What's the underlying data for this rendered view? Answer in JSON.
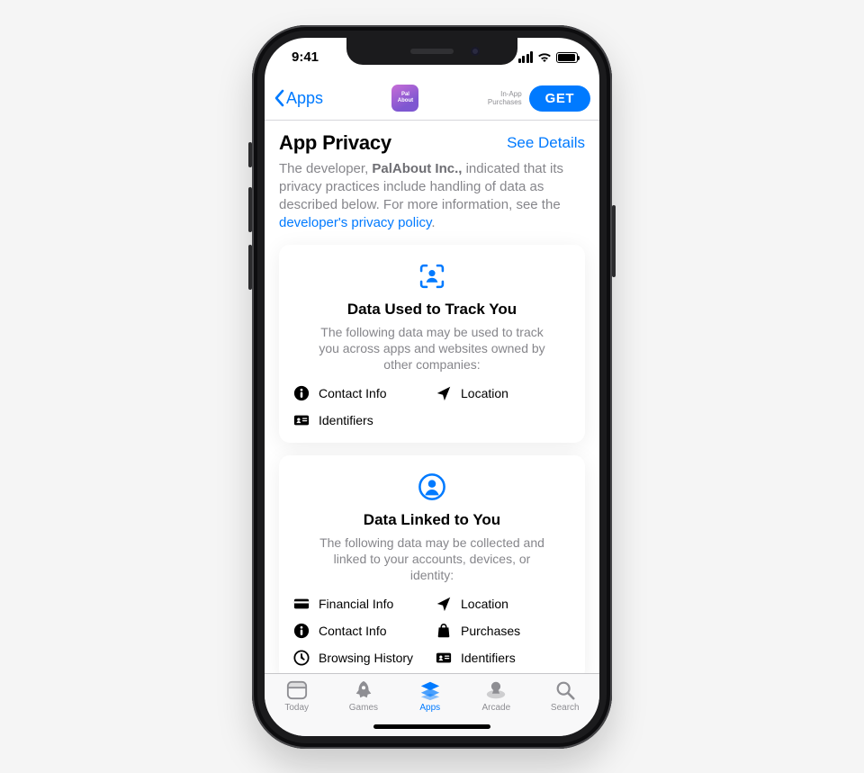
{
  "status": {
    "time": "9:41"
  },
  "nav": {
    "back_label": "Apps",
    "app_icon_text_top": "Pal",
    "app_icon_text_bottom": "About",
    "iap_line1": "In-App",
    "iap_line2": "Purchases",
    "get_label": "GET"
  },
  "header": {
    "title": "App Privacy",
    "see_details": "See Details",
    "desc_prefix": "The developer, ",
    "developer": "PalAbout Inc.,",
    "desc_mid": " indicated that its privacy practices include handling of data as described below. For more information, see the ",
    "policy_link": "developer's privacy policy",
    "desc_suffix": "."
  },
  "cards": {
    "track": {
      "title": "Data Used to Track You",
      "subtitle": "The following data may be used to track you across apps and websites owned by other companies:",
      "items": {
        "contact": "Contact Info",
        "location": "Location",
        "identifiers": "Identifiers"
      }
    },
    "linked": {
      "title": "Data Linked to You",
      "subtitle": "The following data may be collected and linked to your accounts, devices, or identity:",
      "items": {
        "financial": "Financial Info",
        "location": "Location",
        "contact": "Contact Info",
        "purchases": "Purchases",
        "browsing": "Browsing History",
        "identifiers": "Identifiers"
      }
    }
  },
  "tabs": {
    "today": "Today",
    "games": "Games",
    "apps": "Apps",
    "arcade": "Arcade",
    "search": "Search"
  }
}
